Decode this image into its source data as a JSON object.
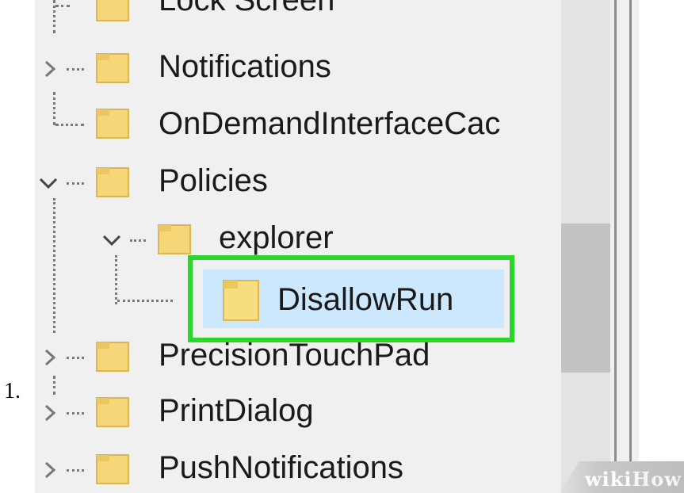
{
  "step_number": "1.",
  "tree": {
    "items": [
      {
        "label": "Lock Screen",
        "expander": "none",
        "icon": "folder-icon"
      },
      {
        "label": "Notifications",
        "expander": "collapsed",
        "icon": "folder-icon"
      },
      {
        "label": "OnDemandInterfaceCac",
        "expander": "none",
        "icon": "folder-icon"
      },
      {
        "label": "Policies",
        "expander": "expanded",
        "icon": "folder-icon"
      },
      {
        "label": "explorer",
        "expander": "expanded",
        "icon": "folder-icon"
      },
      {
        "label": "DisallowRun",
        "expander": "none",
        "icon": "folder-icon",
        "selected": true
      },
      {
        "label": "PrecisionTouchPad",
        "expander": "collapsed",
        "icon": "folder-icon"
      },
      {
        "label": "PrintDialog",
        "expander": "collapsed",
        "icon": "folder-icon"
      },
      {
        "label": "PushNotifications",
        "expander": "collapsed",
        "icon": "folder-icon"
      }
    ]
  },
  "watermark": {
    "part1": "wiki",
    "part2": "How"
  },
  "colors": {
    "pane_bg": "#f0f0f0",
    "selection": "#cce8ff",
    "highlight_border": "#2ad62a",
    "folder": "#f5d77a"
  }
}
